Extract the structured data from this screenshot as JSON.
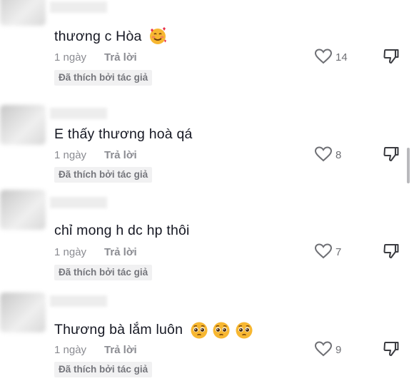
{
  "comments": [
    {
      "text": "thương c Hòa",
      "emoji": [
        "smiling-face-hearts"
      ],
      "time": "1 ngày",
      "reply": "Trả lời",
      "likes": "14",
      "badge": "Đã thích bởi tác giả"
    },
    {
      "text": "E thấy thương hoà qá",
      "emoji": [],
      "time": "1 ngày",
      "reply": "Trả lời",
      "likes": "8",
      "badge": "Đã thích bởi tác giả"
    },
    {
      "text": "chỉ mong h dc hp thôi",
      "emoji": [],
      "time": "1 ngày",
      "reply": "Trả lời",
      "likes": "7",
      "badge": "Đã thích bởi tác giả"
    },
    {
      "text": "Thương bà lắm luôn",
      "emoji": [
        "pleading-face",
        "pleading-face",
        "pleading-face"
      ],
      "time": "1 ngày",
      "reply": "Trả lời",
      "likes": "9",
      "badge": "Đã thích bởi tác giả"
    }
  ],
  "colors": {
    "text": "#161823",
    "meta": "#8a8b91",
    "badge_bg": "#f1f1f2"
  }
}
